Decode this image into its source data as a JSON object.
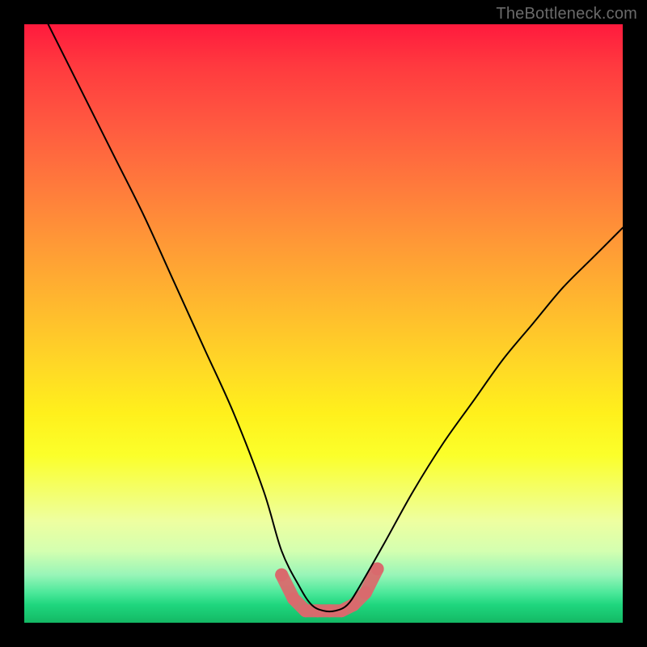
{
  "watermark": "TheBottleneck.com",
  "chart_data": {
    "type": "line",
    "title": "",
    "xlabel": "",
    "ylabel": "",
    "xlim": [
      0,
      100
    ],
    "ylim": [
      0,
      100
    ],
    "background_gradient": {
      "top": "#ff1a3d",
      "upper_mid": "#ff9a36",
      "mid": "#fff01c",
      "lower": "#4be89a",
      "bottom": "#14b864"
    },
    "series": [
      {
        "name": "bottleneck-curve",
        "color": "#000000",
        "stroke_width": 2,
        "x": [
          4,
          10,
          15,
          20,
          25,
          30,
          35,
          40,
          43,
          46,
          48,
          50,
          52,
          54,
          56,
          60,
          65,
          70,
          75,
          80,
          85,
          90,
          95,
          100
        ],
        "y": [
          100,
          88,
          78,
          68,
          57,
          46,
          35,
          22,
          12,
          6,
          3,
          2,
          2,
          3,
          6,
          13,
          22,
          30,
          37,
          44,
          50,
          56,
          61,
          66
        ]
      },
      {
        "name": "valley-markers",
        "color": "#d96a6d",
        "marker_radius": 8,
        "x": [
          43,
          45,
          47,
          49,
          51,
          53,
          55,
          57,
          59
        ],
        "y": [
          8,
          4,
          2,
          2,
          2,
          2,
          3,
          5,
          9
        ]
      }
    ]
  }
}
